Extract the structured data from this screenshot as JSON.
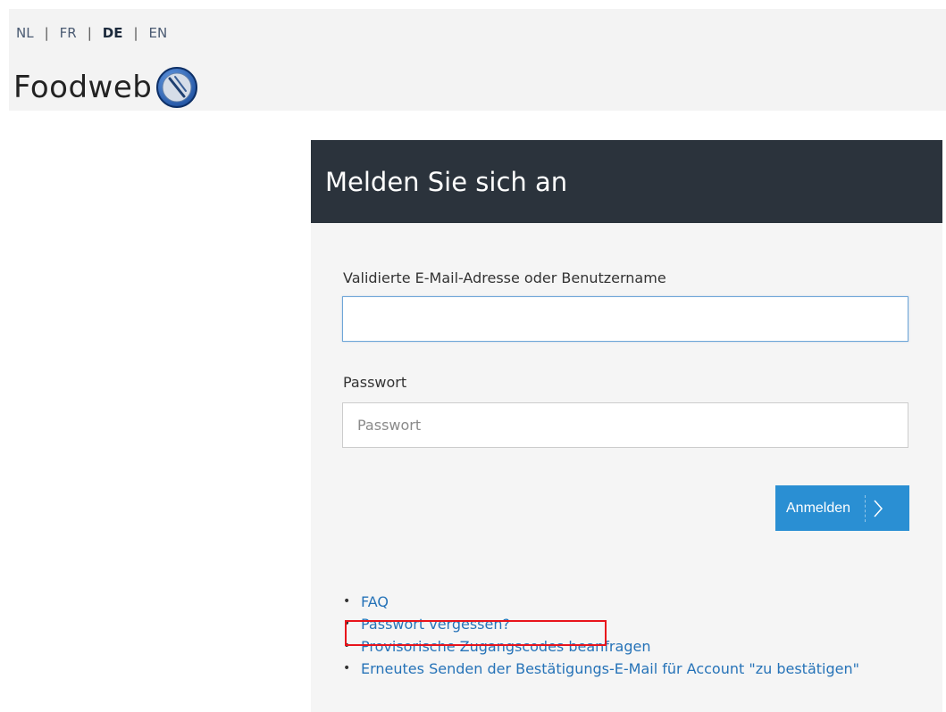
{
  "header": {
    "languages": [
      {
        "code": "NL",
        "active": false
      },
      {
        "code": "FR",
        "active": false
      },
      {
        "code": "DE",
        "active": true
      },
      {
        "code": "EN",
        "active": false
      }
    ],
    "separator": "|",
    "logo_text": "Foodweb",
    "logo_icon": "fork-knife-icon"
  },
  "login": {
    "title": "Melden Sie sich an",
    "username_label": "Validierte E-Mail-Adresse oder Benutzername",
    "username_value": "",
    "password_label": "Passwort",
    "password_placeholder": "Passwort",
    "submit_label": "Anmelden",
    "submit_icon": "chevron-right-icon"
  },
  "links": [
    {
      "label": "FAQ"
    },
    {
      "label": "Passwort vergessen?",
      "highlighted": true
    },
    {
      "label": "Provisorische Zugangscodes beanfragen"
    },
    {
      "label": "Erneutes Senden der Bestätigungs-E-Mail für Account \"zu bestätigen\""
    }
  ],
  "bullet": "•",
  "colors": {
    "header_bg": "#f3f3f3",
    "panel_header_bg": "#2b333c",
    "primary_button": "#2a8fd3",
    "link": "#2673b8",
    "highlight": "#e8141b"
  }
}
